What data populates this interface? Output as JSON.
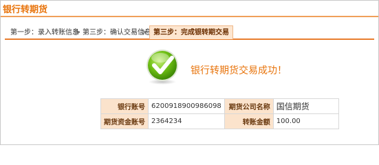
{
  "page": {
    "title": "银行转期货"
  },
  "steps": [
    {
      "label": "第一步：录入转账信息"
    },
    {
      "label": "第三步：确认交易信息"
    },
    {
      "label": "第三步：完成银转期交易"
    }
  ],
  "separator": ">",
  "result": {
    "icon": "success-check-icon",
    "message": "银行转期货交易成功！"
  },
  "info": {
    "rows": [
      {
        "label1": "银行账号",
        "value1": "6200918900986098",
        "label2": "期货公司名称",
        "value2": "国信期货"
      },
      {
        "label1": "期货资金账号",
        "value1": "2364234",
        "label2": "转账金额",
        "value2": "100.00"
      }
    ]
  },
  "colors": {
    "accent": "#e8740c",
    "label_bg": "#fbe3cc",
    "check_green": "#5aa40b"
  }
}
